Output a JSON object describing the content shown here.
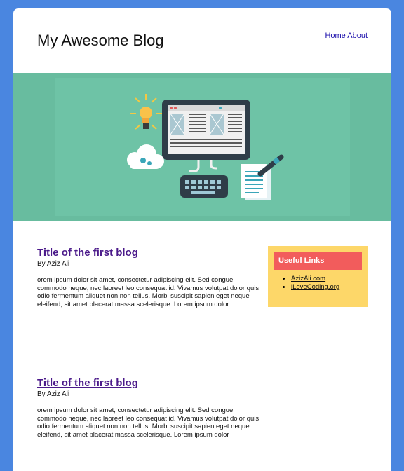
{
  "header": {
    "site_title": "My Awesome Blog",
    "nav": [
      "Home",
      "About"
    ]
  },
  "hero": {
    "illustration": "computer-workspace-illustration"
  },
  "posts": [
    {
      "title": "Title of the first blog",
      "author": "By Aziz Ali",
      "body": "orem ipsum dolor sit amet, consectetur adipiscing elit. Sed congue commodo neque, nec laoreet leo consequat id. Vivamus volutpat dolor quis odio fermentum aliquet non non tellus. Morbi suscipit sapien eget neque eleifend, sit amet placerat massa scelerisque. Lorem ipsum dolor"
    },
    {
      "title": "Title of the first blog",
      "author": "By Aziz Ali",
      "body": "orem ipsum dolor sit amet, consectetur adipiscing elit. Sed congue commodo neque, nec laoreet leo consequat id. Vivamus volutpat dolor quis odio fermentum aliquet non non tellus. Morbi suscipit sapien eget neque eleifend, sit amet placerat massa scelerisque. Lorem ipsum dolor"
    }
  ],
  "sidebar": {
    "title": "Useful Links",
    "links": [
      "AzizAli.com",
      "iLoveCoding.org"
    ]
  },
  "colors": {
    "background": "#4a86e0",
    "hero": "#68bc9f",
    "sidebar": "#fdd769",
    "sidebar_title": "#f25c5c",
    "post_title": "#4b1a8a"
  }
}
